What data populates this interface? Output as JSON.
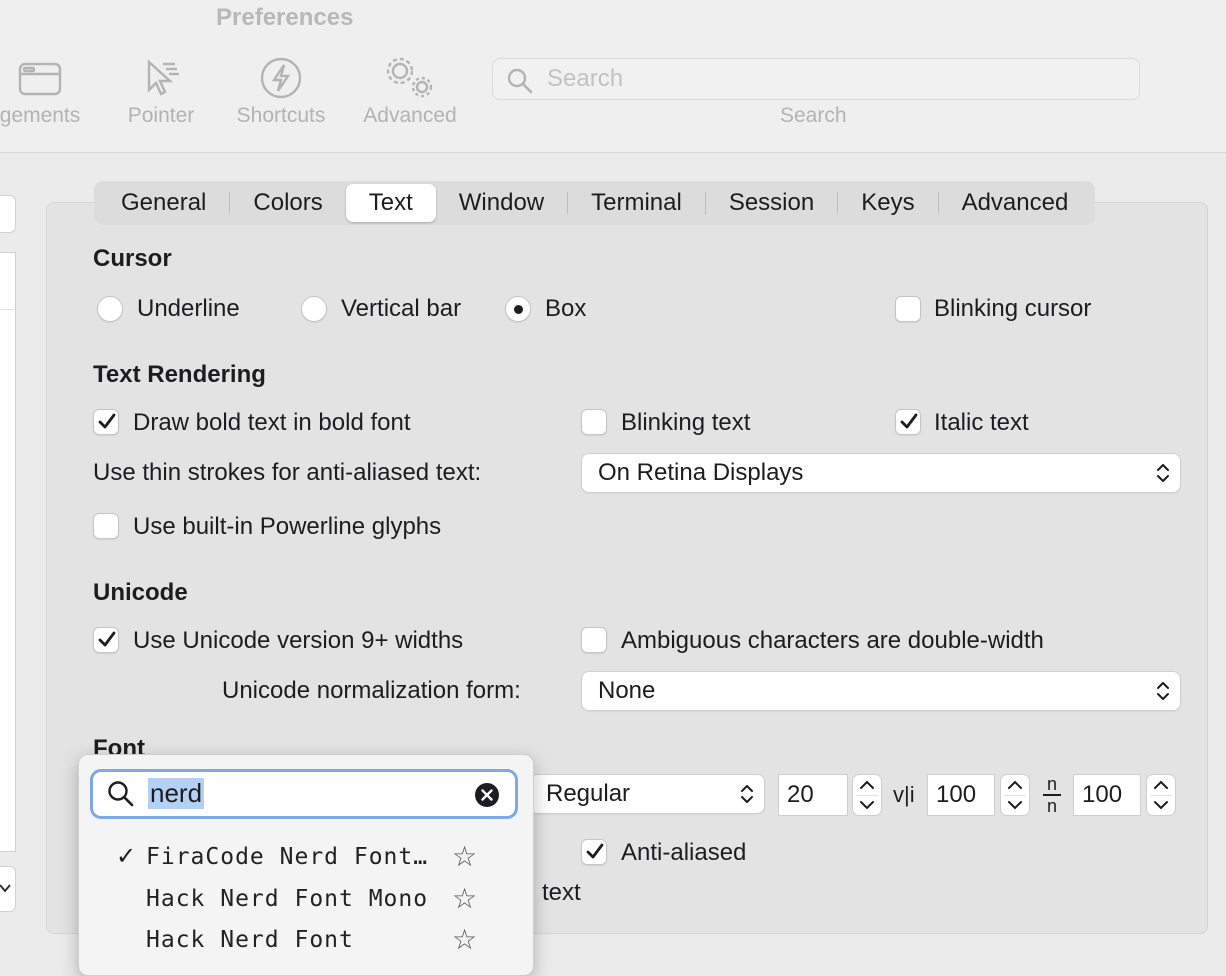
{
  "window": {
    "title": "Preferences"
  },
  "toolbar": {
    "items": [
      {
        "label": "gements",
        "icon": "window-icon"
      },
      {
        "label": "Pointer",
        "icon": "pointer-icon"
      },
      {
        "label": "Shortcuts",
        "icon": "bolt-icon"
      },
      {
        "label": "Advanced",
        "icon": "gears-icon"
      }
    ],
    "search": {
      "placeholder": "Search",
      "caption": "Search"
    }
  },
  "tabs": [
    "General",
    "Colors",
    "Text",
    "Window",
    "Terminal",
    "Session",
    "Keys",
    "Advanced"
  ],
  "selected_tab": "Text",
  "cursor": {
    "heading": "Cursor",
    "options": [
      "Underline",
      "Vertical bar",
      "Box"
    ],
    "selected": "Box",
    "blinking_label": "Blinking cursor",
    "blinking": false
  },
  "text_rendering": {
    "heading": "Text Rendering",
    "bold_label": "Draw bold text in bold font",
    "bold": true,
    "blinking_text_label": "Blinking text",
    "blinking_text": false,
    "italic_label": "Italic text",
    "italic": true,
    "thin_strokes_label": "Use thin strokes for anti-aliased text:",
    "thin_strokes_value": "On Retina Displays",
    "powerline_label": "Use built-in Powerline glyphs",
    "powerline": false
  },
  "unicode": {
    "heading": "Unicode",
    "v9_label": "Use Unicode version 9+ widths",
    "v9": true,
    "ambiguous_label": "Ambiguous characters are double-width",
    "ambiguous": false,
    "normalization_label": "Unicode normalization form:",
    "normalization_value": "None"
  },
  "font": {
    "heading": "Font",
    "style": "Regular",
    "size": "20",
    "vli_glyph": "v|i",
    "h_spacing": "100",
    "n_glyph": "n",
    "v_spacing": "100",
    "anti_aliased_label": "Anti-aliased",
    "anti_aliased": true,
    "partial_label": "l text",
    "search_query": "nerd",
    "results": [
      {
        "name": "FiraCode Nerd Font…",
        "checked": true
      },
      {
        "name": "Hack Nerd Font Mono",
        "checked": false
      },
      {
        "name": "Hack Nerd Font",
        "checked": false
      }
    ],
    "check_glyph": "✓",
    "star_glyph": "☆"
  }
}
